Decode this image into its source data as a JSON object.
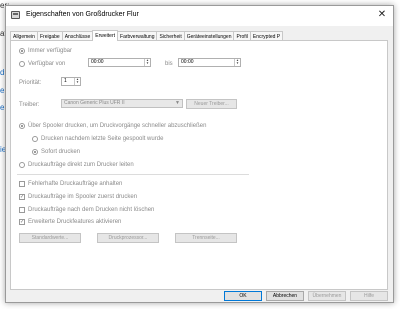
{
  "background": {
    "fragments": [
      "er:",
      "ata",
      "dr",
      "eh",
      "e",
      "ie"
    ]
  },
  "dialog": {
    "title": "Eigenschaften von Großdrucker Flur",
    "close_symbol": "✕",
    "tabs": [
      "Allgemein",
      "Freigabe",
      "Anschlüsse",
      "Erweitert",
      "Farbverwaltung",
      "Sicherheit",
      "Geräteeinstellungen",
      "Profil",
      "Encrypted P"
    ],
    "active_tab": "Erweitert",
    "availability": {
      "always_label": "Immer verfügbar",
      "from_label": "Verfügbar von",
      "from_value": "00:00",
      "to_label": "bis",
      "to_value": "00:00"
    },
    "priority": {
      "label": "Priorität:",
      "value": "1"
    },
    "driver": {
      "label": "Treiber:",
      "value": "Canon Generic Plus UFR II",
      "new_button": "Neuer Treiber..."
    },
    "spooling": {
      "spool_label": "Über Spooler drucken, um Druckvorgänge schneller abzuschließen",
      "after_last_page": "Drucken nachdem letzte Seite gespoolt wurde",
      "immediately": "Sofort drucken",
      "direct": "Druckaufträge direkt zum Drucker leiten"
    },
    "options": [
      {
        "label": "Fehlerhafte Druckaufträge anhalten",
        "checked": false
      },
      {
        "label": "Druckaufträge im Spooler zuerst drucken",
        "checked": true
      },
      {
        "label": "Druckaufträge nach dem Drucken nicht löschen",
        "checked": false
      },
      {
        "label": "Erweiterte Druckfeatures aktivieren",
        "checked": true
      }
    ],
    "panel_buttons": [
      "Standardwerte...",
      "Druckprozessor...",
      "Trennseite..."
    ],
    "footer_buttons": {
      "ok": "OK",
      "cancel": "Abbrechen",
      "apply": "Übernehmen",
      "help": "Hilfe"
    },
    "check_mark": "✓"
  }
}
